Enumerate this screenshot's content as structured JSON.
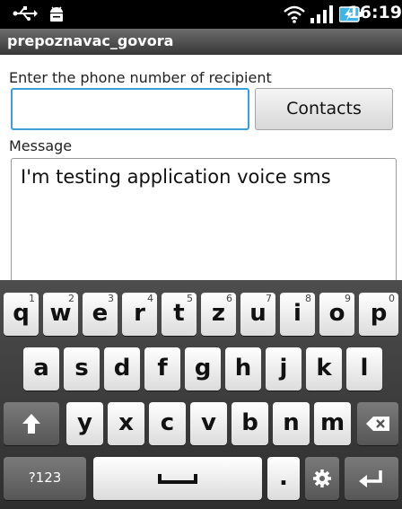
{
  "status_bar": {
    "time": "16:19",
    "icons": [
      "usb-icon",
      "android-debug-icon",
      "wifi-icon",
      "signal-icon",
      "battery-charging-icon"
    ]
  },
  "app": {
    "title": "prepoznavac_govora"
  },
  "form": {
    "phone_label": "Enter the phone number of recipient",
    "phone_value": "",
    "contacts_label": "Contacts",
    "message_label": "Message",
    "message_value": "I'm testing application voice sms"
  },
  "keyboard": {
    "row1": [
      {
        "k": "q",
        "n": "1"
      },
      {
        "k": "w",
        "n": "2"
      },
      {
        "k": "e",
        "n": "3"
      },
      {
        "k": "r",
        "n": "4"
      },
      {
        "k": "t",
        "n": "5"
      },
      {
        "k": "z",
        "n": "6"
      },
      {
        "k": "u",
        "n": "7"
      },
      {
        "k": "i",
        "n": "8"
      },
      {
        "k": "o",
        "n": "9"
      },
      {
        "k": "p",
        "n": "0"
      }
    ],
    "row2": [
      "a",
      "s",
      "d",
      "f",
      "g",
      "h",
      "j",
      "k",
      "l"
    ],
    "row3": [
      "y",
      "x",
      "c",
      "v",
      "b",
      "n",
      "m"
    ],
    "symbols_label": "?123",
    "period": ".",
    "icons": [
      "shift-icon",
      "backspace-icon",
      "space-icon",
      "settings-icon",
      "enter-icon"
    ]
  },
  "colors": {
    "focus": "#3aa0d8",
    "status_bg": "#000000",
    "keyboard_bg": "#3a3a3a"
  }
}
